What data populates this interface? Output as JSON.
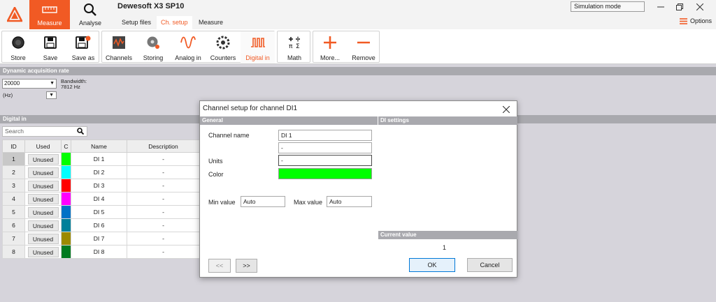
{
  "app": {
    "title": "Dewesoft X3 SP10",
    "brand_color": "#f15a24",
    "modes": [
      {
        "label": "Measure",
        "icon": "ruler-icon"
      },
      {
        "label": "Analyse",
        "icon": "magnifier-icon"
      }
    ],
    "subtabs": [
      "Setup files",
      "Ch. setup",
      "Measure"
    ],
    "simulation_mode": "Simulation mode",
    "options_label": "Options"
  },
  "ribbon": {
    "file": [
      {
        "label": "Store",
        "icon": "record-icon"
      },
      {
        "label": "Save",
        "icon": "floppy-icon"
      },
      {
        "label": "Save as",
        "icon": "floppy-edit-icon"
      }
    ],
    "channels": [
      {
        "label": "Channels",
        "icon": "channels-icon"
      },
      {
        "label": "Storing",
        "icon": "storing-icon"
      },
      {
        "label": "Analog in",
        "icon": "sine-wave-icon"
      },
      {
        "label": "Counters",
        "icon": "counter-icon"
      },
      {
        "label": "Digital in",
        "icon": "digital-pulse-icon"
      }
    ],
    "math": {
      "label": "Math",
      "icon": "math-icon"
    },
    "more": {
      "label": "More...",
      "icon": "plus-icon"
    },
    "remove": {
      "label": "Remove",
      "icon": "minus-icon"
    }
  },
  "acquisition": {
    "section_title": "Dynamic acquisition rate",
    "rate_value": "20000",
    "unit_value": "(Hz)",
    "bandwidth_label": "Bandwidth:",
    "bandwidth_value": "7812 Hz"
  },
  "digital_in": {
    "section_title": "Digital in",
    "search_placeholder": "Search",
    "columns": [
      "ID",
      "Used",
      "C",
      "Name",
      "Description"
    ],
    "rows": [
      {
        "id": "1",
        "used": "Unused",
        "color": "#00ff00",
        "name": "DI 1",
        "description": "-"
      },
      {
        "id": "2",
        "used": "Unused",
        "color": "#00ffff",
        "name": "DI 2",
        "description": "-"
      },
      {
        "id": "3",
        "used": "Unused",
        "color": "#ff0000",
        "name": "DI 3",
        "description": "-"
      },
      {
        "id": "4",
        "used": "Unused",
        "color": "#ff00ff",
        "name": "DI 4",
        "description": "-"
      },
      {
        "id": "5",
        "used": "Unused",
        "color": "#0072c6",
        "name": "DI 5",
        "description": "-"
      },
      {
        "id": "6",
        "used": "Unused",
        "color": "#00809a",
        "name": "DI 6",
        "description": "-"
      },
      {
        "id": "7",
        "used": "Unused",
        "color": "#9b8a00",
        "name": "DI 7",
        "description": "-"
      },
      {
        "id": "8",
        "used": "Unused",
        "color": "#007a1f",
        "name": "DI 8",
        "description": "-"
      }
    ]
  },
  "dialog": {
    "title": "Channel setup for channel DI1",
    "general_title": "General",
    "di_settings_title": "DI settings",
    "channel_name_label": "Channel name",
    "channel_name_value": "DI 1",
    "description_value": "-",
    "units_label": "Units",
    "units_value": "-",
    "color_label": "Color",
    "color_value": "#00ff00",
    "min_label": "Min value",
    "min_value": "Auto",
    "max_label": "Max value",
    "max_value": "Auto",
    "current_value_title": "Current value",
    "current_value": "1",
    "prev_label": "<<",
    "next_label": ">>",
    "ok_label": "OK",
    "cancel_label": "Cancel"
  }
}
